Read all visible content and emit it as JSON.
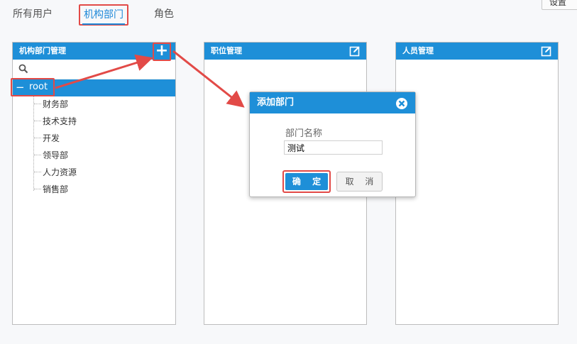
{
  "header": {
    "settings_label": "设置",
    "tabs": [
      {
        "label": "所有用户"
      },
      {
        "label": "机构部门"
      },
      {
        "label": "角色"
      }
    ]
  },
  "panels": {
    "org": {
      "title": "机构部门管理",
      "add_icon": "+",
      "root_label": "root",
      "departments": [
        "财务部",
        "技术支持",
        "开发",
        "领导部",
        "人力资源",
        "销售部"
      ]
    },
    "position": {
      "title": "职位管理"
    },
    "staff": {
      "title": "人员管理"
    }
  },
  "dialog": {
    "title": "添加部门",
    "field_label": "部门名称",
    "field_value": "测试",
    "ok_label": "确 定",
    "cancel_label": "取 消"
  },
  "colors": {
    "accent": "#1e8fd8",
    "highlight": "#e24a47"
  }
}
